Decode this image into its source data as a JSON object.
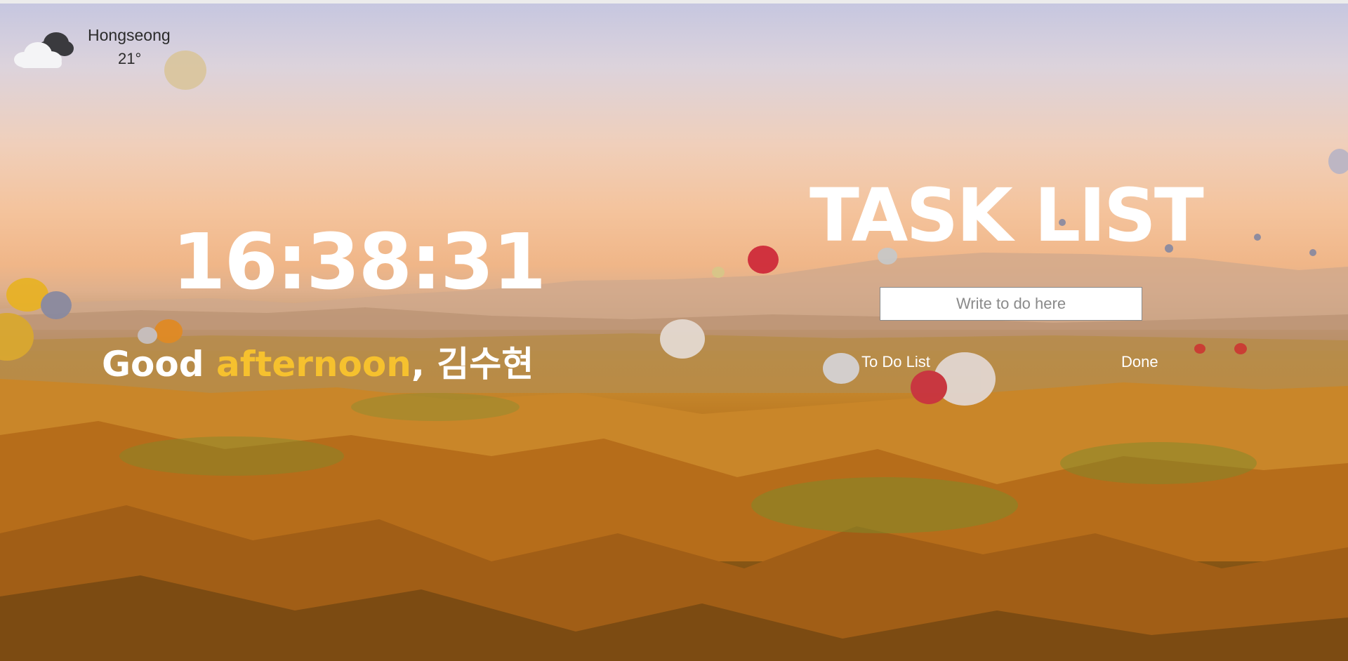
{
  "weather": {
    "icon": "cloud-icon",
    "city": "Hongseong",
    "temperature": "21°"
  },
  "clock": {
    "time": "16:38:31"
  },
  "greeting": {
    "prefix": "Good ",
    "period": "afternoon",
    "separator": ", ",
    "name": "김수현"
  },
  "tasks": {
    "title": "TASK LIST",
    "input_placeholder": "Write to do here",
    "todo_label": "To Do List",
    "done_label": "Done"
  },
  "colors": {
    "accent_period": "#f6c12e",
    "text_primary": "#ffffff"
  }
}
